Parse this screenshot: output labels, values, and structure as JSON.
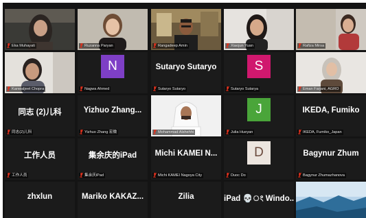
{
  "colors": {
    "background": "#141414",
    "tile": "#1b1b1b",
    "muted_mic": "#e0321e",
    "label_text": "#e8e8e8",
    "speaker_outline": "#e3a93b"
  },
  "participants": [
    {
      "label": "Eka Muhayati",
      "type": "video",
      "scene": "woman-hijab"
    },
    {
      "label": "Ruzanna Paryan",
      "type": "video",
      "scene": "woman-light"
    },
    {
      "label": "Rangadeep Amin",
      "type": "video",
      "scene": "man-glasses"
    },
    {
      "label": "Xiaojun Yuan",
      "type": "video",
      "scene": "woman-dark-hair"
    },
    {
      "label": "Rafiza Mirsa",
      "type": "video",
      "scene": "woman-corner"
    },
    {
      "label": "Kanwaljeet Chopra",
      "type": "video",
      "scene": "woman-bob"
    },
    {
      "label": "Nagwa Ahmed",
      "type": "avatar",
      "letter": "N",
      "color": "#7e3fc6"
    },
    {
      "label": "Sutaryo Sutaryo",
      "type": "name",
      "display": "Sutaryo Sutaryo"
    },
    {
      "label": "Sutaryo Sutarya",
      "type": "avatar",
      "letter": "S",
      "color": "#d0186e"
    },
    {
      "label": "Eman Farjani, AGRO",
      "type": "video",
      "scene": "woman-hijab-light"
    },
    {
      "label": "同志(2)儿科",
      "type": "name",
      "display": "同志 (2)儿科"
    },
    {
      "label": "Yizhuo Zhang 宏微",
      "type": "name",
      "display": "Yizhuo Zhang..."
    },
    {
      "label": "Mohammad Alshehhi",
      "type": "video",
      "scene": "man-ghutra"
    },
    {
      "label": "Julia Hueyan",
      "type": "avatar",
      "letter": "J",
      "color": "#4aa53a"
    },
    {
      "label": "IKEDA, Fumiko_Japan",
      "type": "name",
      "display": "IKEDA, Fumiko"
    },
    {
      "label": "工作人员",
      "type": "name",
      "display": "工作人员"
    },
    {
      "label": "集余庆iPad",
      "type": "name",
      "display": "集余庆的iPad"
    },
    {
      "label": "Michi KAMEI Nagoya City",
      "type": "name",
      "display": "Michi KAMEI N..."
    },
    {
      "label": "Duoc Do",
      "type": "avatar",
      "letter": "D",
      "color": "#ece5df",
      "letter_color": "#6b4a3d"
    },
    {
      "label": "Bagynur Zhumazhanova",
      "type": "name",
      "display": "Bagynur Zhum"
    },
    {
      "label": "",
      "type": "name",
      "display": "zhxlun"
    },
    {
      "label": "",
      "type": "name",
      "display": "Mariko KAKAZ..."
    },
    {
      "label": "",
      "type": "name",
      "display": "Zilia"
    },
    {
      "label": "",
      "type": "name",
      "display": "iPad 💀ং Windo..."
    },
    {
      "label": "",
      "type": "video",
      "scene": "landscape"
    }
  ]
}
